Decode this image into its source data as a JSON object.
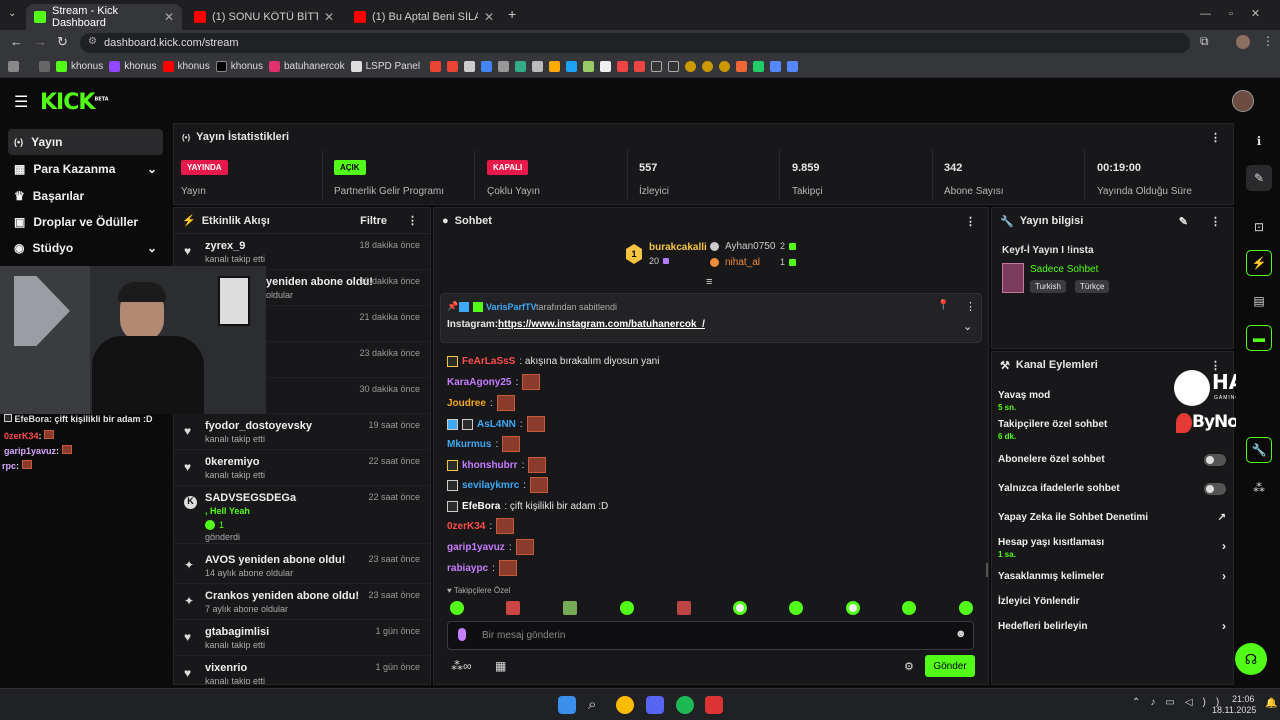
{
  "browser": {
    "tabs": [
      {
        "title": "Stream - Kick Dashboard"
      },
      {
        "title": "(1) SONU KÖTÜ BİTTİ: Türkiye'"
      },
      {
        "title": "(1) Bu Aptal Beni SİLAHLA GAS"
      }
    ],
    "url": "dashboard.kick.com/stream",
    "bookmarks": [
      "khonus",
      "khonus",
      "khonus",
      "khonus",
      "batuhanercok",
      "LSPD Panel"
    ]
  },
  "app": {
    "logo": "KICK",
    "logo_sup": "BETA"
  },
  "nav": {
    "items": [
      {
        "label": "Yayın",
        "icon": "(•)"
      },
      {
        "label": "Para Kazanma",
        "icon": "▦"
      },
      {
        "label": "Başarılar",
        "icon": "🏆"
      },
      {
        "label": "Droplar ve Ödüller",
        "icon": "▣"
      },
      {
        "label": "Stüdyo",
        "icon": "◉"
      }
    ]
  },
  "stats": {
    "title": "Yayın İstatistikleri",
    "cells": [
      {
        "badge": "YAYINDA",
        "label": "Yayın"
      },
      {
        "badge": "AÇIK",
        "label": "Partnerlik Gelir Programı"
      },
      {
        "badge": "KAPALI",
        "label": "Çoklu Yayın"
      },
      {
        "value": "557",
        "label": "İzleyici"
      },
      {
        "value": "9.859",
        "label": "Takipçi"
      },
      {
        "value": "342",
        "label": "Abone Sayısı"
      },
      {
        "value": "00:19:00",
        "label": "Yayında Olduğu Süre"
      }
    ]
  },
  "activity": {
    "title": "Etkinlik Akışı",
    "filter": "Filtre",
    "items": [
      {
        "name": "zyrex_9",
        "sub": "kanalı takip etti",
        "time": "18 dakika önce",
        "icon": "♥"
      },
      {
        "name": "yeniden abone oldu!",
        "sub": "oldular",
        "time": "19 dakika önce",
        "icon": ""
      },
      {
        "name": "",
        "sub": "",
        "time": "21 dakika önce",
        "icon": ""
      },
      {
        "name": "",
        "sub": "",
        "time": "23 dakika önce",
        "icon": ""
      },
      {
        "name": "",
        "sub": "",
        "time": "30 dakika önce",
        "icon": ""
      },
      {
        "name": "fyodor_dostoyevsky",
        "sub": "kanalı takip etti",
        "time": "19 saat önce",
        "icon": "♥"
      },
      {
        "name": "0keremiyo",
        "sub": "kanalı takip etti",
        "time": "22 saat önce",
        "icon": "♥"
      },
      {
        "name": "SADVSEGSDEGa",
        "sub": ", Hell Yeah",
        "time": "22 saat önce",
        "icon": "K"
      },
      {
        "name": "AVOS yeniden abone oldu!",
        "sub": "14 aylık abone oldular",
        "time": "23 saat önce",
        "icon": "✦"
      },
      {
        "name": "Crankos yeniden abone oldu!",
        "sub": "7 aylık abone oldular",
        "time": "23 saat önce",
        "icon": "✦"
      },
      {
        "name": "gtabagimlisi",
        "sub": "kanalı takip etti",
        "time": "1 gün önce",
        "icon": "♥"
      },
      {
        "name": "vixenrio",
        "sub": "kanalı takip etti",
        "time": "1 gün önce",
        "icon": "♥"
      }
    ],
    "gift_count": "1",
    "gift_label": "gönderdi"
  },
  "overlay_chat": [
    {
      "user": "EfeBora",
      "msg": ": çift kişilikli bir adam :D",
      "color": "#ffffff"
    },
    {
      "user": "0zerK34",
      "msg": ":",
      "color": "#ff4d4d"
    },
    {
      "user": "garip1yavuz",
      "msg": ":",
      "color": "#c77dff"
    },
    {
      "user": "rpc",
      "msg": ":",
      "color": "#c77dff"
    }
  ],
  "chat": {
    "title": "Sohbet",
    "top": [
      {
        "user": "burakcakalli",
        "value": "20",
        "color": "#f5c542"
      },
      {
        "user": "Ayhan0750",
        "value": "2",
        "color": "#cccccc"
      },
      {
        "user": "nihat_al",
        "value": "1",
        "color": "#f08c3c"
      }
    ],
    "pinned_by_user": "VarisParfTV",
    "pinned_by_suffix": "tarafından sabitlendi",
    "pinned_label": "Instagram:",
    "pinned_link": "https://www.instagram.com/batuhanercok_/",
    "messages": [
      {
        "user": "FeArLaSsS",
        "text": ": akışına bırakalım diyosun yani",
        "color": "#ff4d4d",
        "emote": false
      },
      {
        "user": "KaraAgony25",
        "text": ":",
        "color": "#c77dff",
        "emote": true
      },
      {
        "user": "Joudree",
        "text": ":",
        "color": "#f5a623",
        "emote": true
      },
      {
        "user": "AsL4NN",
        "text": ":",
        "color": "#3fa9f5",
        "emote": true
      },
      {
        "user": "Mkurmus",
        "text": ":",
        "color": "#3fa9f5",
        "emote": true
      },
      {
        "user": "khonshubrr",
        "text": ":",
        "color": "#c77dff",
        "emote": true
      },
      {
        "user": "sevilaykmrc",
        "text": ":",
        "color": "#3fa9f5",
        "emote": true
      },
      {
        "user": "EfeBora",
        "text": ": çift kişilikli bir adam :D",
        "color": "#ffffff",
        "emote": false
      },
      {
        "user": "0zerK34",
        "text": ":",
        "color": "#ff4d4d",
        "emote": true
      },
      {
        "user": "garip1yavuz",
        "text": ":",
        "color": "#c77dff",
        "emote": true
      },
      {
        "user": "rabiaypc",
        "text": ":",
        "color": "#c77dff",
        "emote": true
      }
    ],
    "followers_only": "Takipçilere Özel",
    "input_placeholder": "Bir mesaj gönderin",
    "send_label": "Gönder"
  },
  "stream_info": {
    "title": "Yayın bilgisi",
    "stream_title": "Keyf-İ Yayın I !insta",
    "category": "Sadece Sohbet",
    "tags": [
      "Turkish",
      "Türkçe"
    ]
  },
  "channel_actions": {
    "title": "Kanal Eylemleri",
    "items": [
      {
        "label": "Yavaş mod",
        "sub": "5 sn."
      },
      {
        "label": "Takipçilere özel sohbet",
        "sub": "6 dk."
      },
      {
        "label": "Abonelere özel sohbet",
        "sub": ""
      },
      {
        "label": "Yalnızca ifadelerle sohbet",
        "sub": ""
      },
      {
        "label": "Yapay Zeka ile Sohbet Denetimi",
        "sub": ""
      },
      {
        "label": "Hesap yaşı kısıtlaması",
        "sub": "1 sa."
      },
      {
        "label": "Yasaklanmış kelimeler",
        "sub": ""
      },
      {
        "label": "İzleyici Yönlendir",
        "sub": ""
      },
      {
        "label": "Hedefleri belirleyin",
        "sub": ""
      }
    ]
  },
  "watermark": {
    "hawk": "HAWK",
    "hawk_sub": "GAMING CHAIR",
    "bynogame": "ByNoGame"
  },
  "taskbar": {
    "time": "21:06",
    "date": "18.11.2025"
  },
  "colors": {
    "accent": "#53fc18",
    "live": "#e5194a",
    "panel": "#18181b"
  }
}
